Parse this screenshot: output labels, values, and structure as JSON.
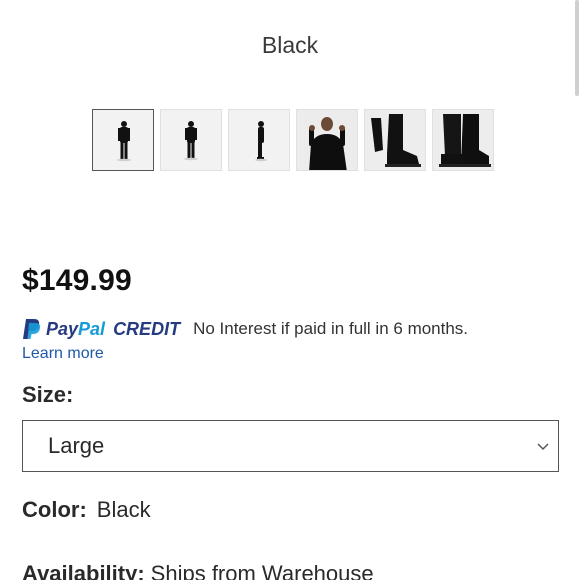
{
  "product": {
    "color_title": "Black",
    "thumbnails": [
      {
        "alt": "full-body-front-view"
      },
      {
        "alt": "full-body-back-view"
      },
      {
        "alt": "full-body-side-view"
      },
      {
        "alt": "upper-body-view"
      },
      {
        "alt": "boots-closeup"
      },
      {
        "alt": "boots-closeup-2"
      }
    ],
    "price": "$149.99"
  },
  "paypal": {
    "brand_pay": "Pay",
    "brand_pal": "Pal",
    "credit": "CREDIT",
    "message": "No Interest if paid in full in 6 months.",
    "learn_more": "Learn more",
    "colors": {
      "dark_blue": "#253b80",
      "light_blue": "#179bd7"
    }
  },
  "size": {
    "label": "Size:",
    "selected": "Large"
  },
  "color": {
    "label": "Color:",
    "value": "Black"
  },
  "availability": {
    "label": "Availability:",
    "value": "Ships from Warehouse"
  }
}
